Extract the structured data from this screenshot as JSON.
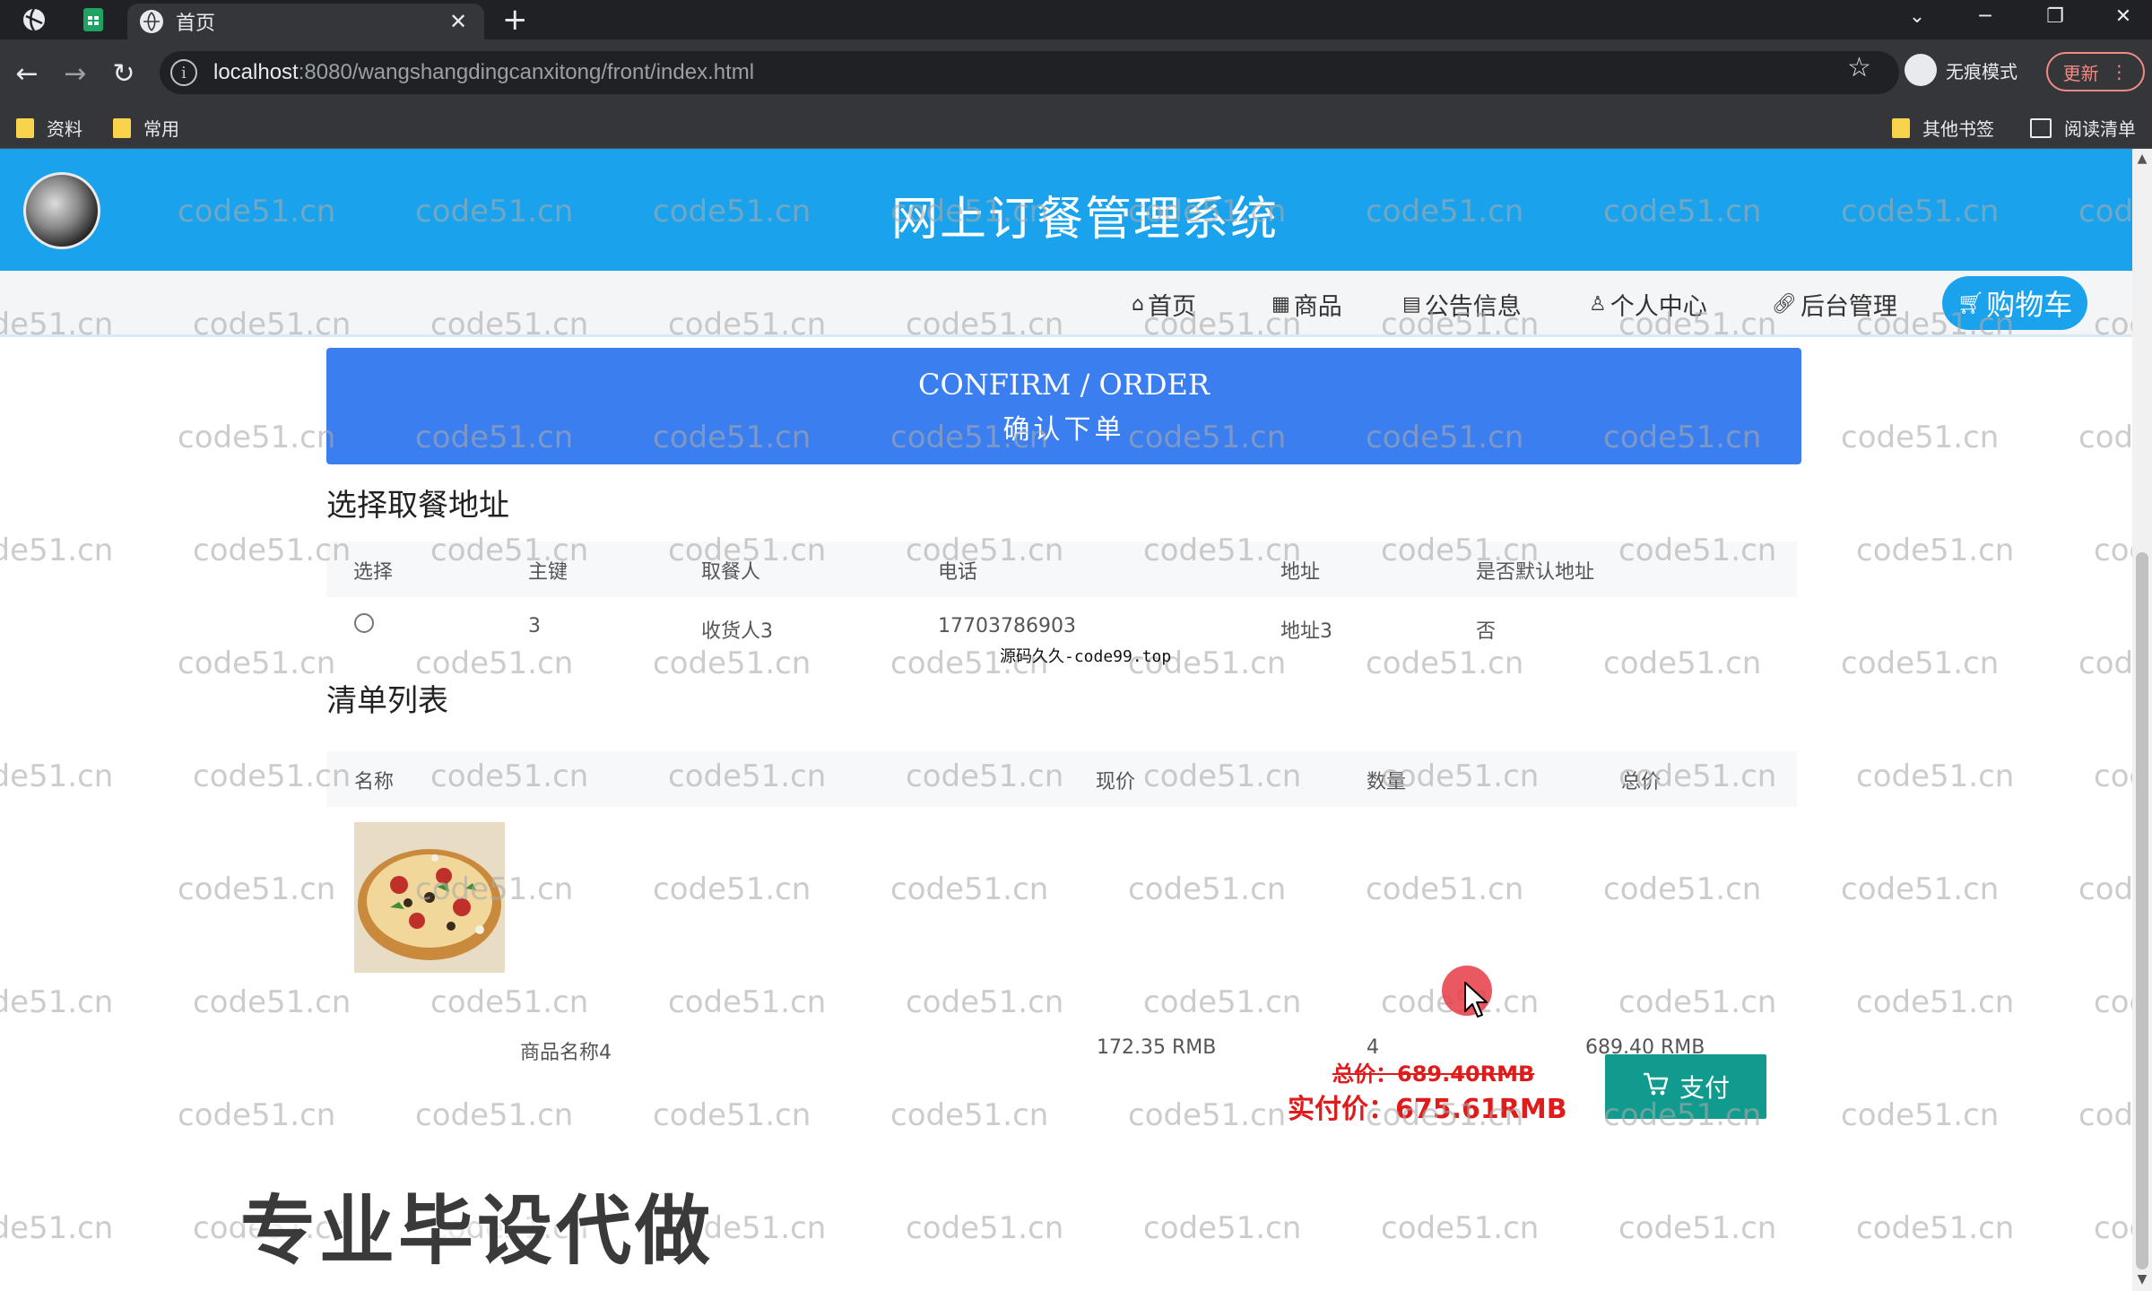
{
  "browser": {
    "tab_title": "首页",
    "url_host": "localhost",
    "url_rest": ":8080/wangshangdingcanxitong/front/index.html",
    "incognito_label": "无痕模式",
    "update_label": "更新",
    "bookmarks": [
      "资料",
      "常用"
    ],
    "bookmarks_right": [
      "其他书签",
      "阅读清单"
    ]
  },
  "site": {
    "title": "网上订餐管理系统",
    "menu": [
      "首页",
      "商品",
      "公告信息",
      "个人中心",
      "后台管理"
    ],
    "cart_label": "购物车"
  },
  "confirm": {
    "en": "CONFIRM / ORDER",
    "cn": "确认下单"
  },
  "address": {
    "title": "选择取餐地址",
    "headers": [
      "选择",
      "主键",
      "取餐人",
      "电话",
      "地址",
      "是否默认地址"
    ],
    "rows": [
      {
        "id": "3",
        "name": "收货人3",
        "phone": "17703786903",
        "addr": "地址3",
        "default": "否"
      }
    ]
  },
  "order": {
    "title": "清单列表",
    "headers": [
      "名称",
      "现价",
      "数量",
      "总价"
    ],
    "items": [
      {
        "name": "商品名称4",
        "price": "172.35 RMB",
        "qty": "4",
        "total": "689.40 RMB"
      }
    ],
    "total_old": "总价：689.40RMB",
    "total_real": "实付价：675.61RMB",
    "pay_label": "支付"
  },
  "overlay": {
    "watermark": "code51.cn",
    "source_mark": "源码久久-code99.top",
    "promo": "专业毕设代做"
  },
  "colors": {
    "header_blue": "#1aa3ec",
    "banner_blue": "#3a7ef0",
    "pay_green": "#119a8e",
    "price_red": "#e01b1b"
  }
}
